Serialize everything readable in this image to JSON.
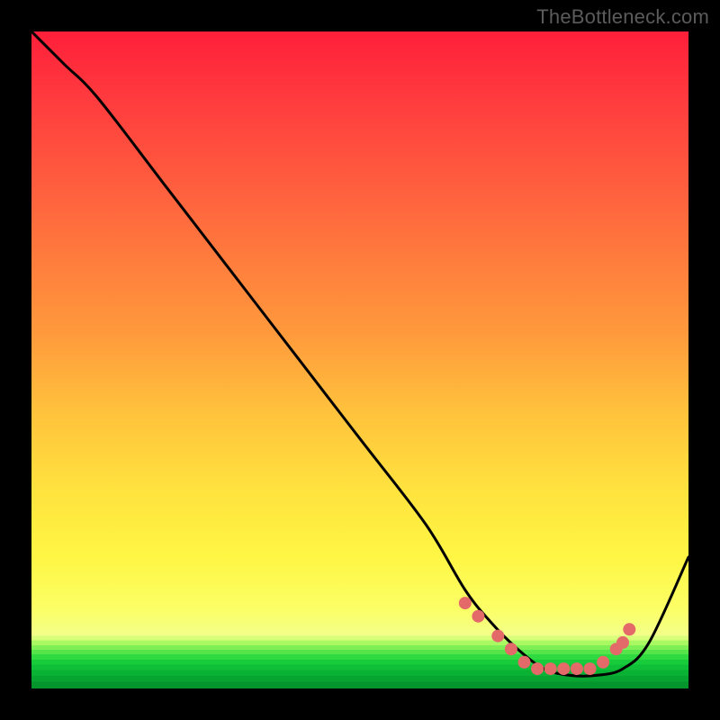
{
  "watermark": "TheBottleneck.com",
  "chart_data": {
    "type": "line",
    "title": "",
    "xlabel": "",
    "ylabel": "",
    "xlim": [
      0,
      100
    ],
    "ylim": [
      0,
      100
    ],
    "series": [
      {
        "name": "bottleneck-curve",
        "x": [
          0,
          5,
          10,
          20,
          30,
          40,
          50,
          60,
          66,
          70,
          74,
          78,
          82,
          86,
          90,
          94,
          100
        ],
        "values": [
          100,
          95,
          90,
          77,
          64,
          51,
          38,
          25,
          15,
          10,
          6,
          3,
          2,
          2,
          3,
          7,
          20
        ]
      }
    ],
    "markers": {
      "name": "highlight-beads",
      "x": [
        66,
        68,
        71,
        73,
        75,
        77,
        79,
        81,
        83,
        85,
        87,
        89,
        90,
        91
      ],
      "values": [
        13,
        11,
        8,
        6,
        4,
        3,
        3,
        3,
        3,
        3,
        4,
        6,
        7,
        9
      ],
      "color": "#e46a6a",
      "radius": 7
    },
    "gradient_stops": [
      {
        "pos": 0.0,
        "color": "#ff1f3a"
      },
      {
        "pos": 0.5,
        "color": "#ffb23c"
      },
      {
        "pos": 0.8,
        "color": "#fff644"
      },
      {
        "pos": 0.92,
        "color": "#f3ff8a"
      },
      {
        "pos": 0.96,
        "color": "#2fd940"
      },
      {
        "pos": 1.0,
        "color": "#05952d"
      }
    ]
  }
}
